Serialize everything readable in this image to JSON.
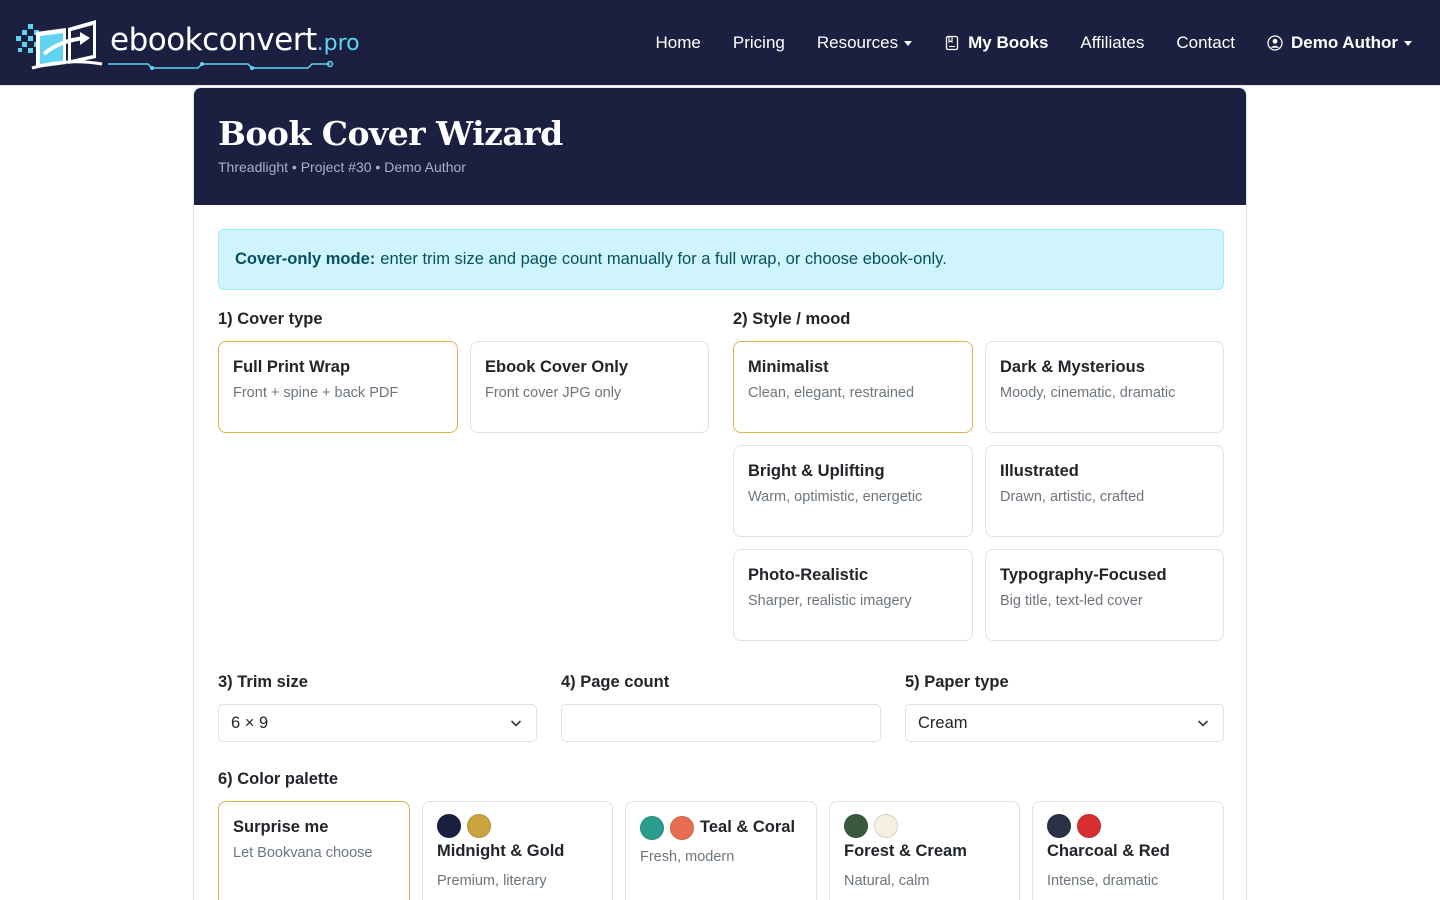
{
  "brand": {
    "name_main": "ebookconvert",
    "name_suffix": ".pro",
    "colors": {
      "navy": "#1b2040",
      "accent": "#5fd4f0",
      "selected_border": "#e0b24a"
    }
  },
  "nav": {
    "home": "Home",
    "pricing": "Pricing",
    "resources": "Resources",
    "my_books": "My Books",
    "affiliates": "Affiliates",
    "contact": "Contact",
    "user": "Demo Author"
  },
  "header": {
    "title": "Book Cover Wizard",
    "subtitle": "Threadlight • Project #30 • Demo Author"
  },
  "alert": {
    "strong": "Cover-only mode:",
    "text": "enter trim size and page count manually for a full wrap, or choose ebook-only."
  },
  "cover_type": {
    "label": "1) Cover type",
    "options": [
      {
        "title": "Full Print Wrap",
        "desc": "Front + spine + back PDF",
        "selected": true
      },
      {
        "title": "Ebook Cover Only",
        "desc": "Front cover JPG only",
        "selected": false
      }
    ]
  },
  "style": {
    "label": "2) Style / mood",
    "options": [
      {
        "title": "Minimalist",
        "desc": "Clean, elegant, restrained",
        "selected": true
      },
      {
        "title": "Dark & Mysterious",
        "desc": "Moody, cinematic, dramatic",
        "selected": false
      },
      {
        "title": "Bright & Uplifting",
        "desc": "Warm, optimistic, energetic",
        "selected": false
      },
      {
        "title": "Illustrated",
        "desc": "Drawn, artistic, crafted",
        "selected": false
      },
      {
        "title": "Photo-Realistic",
        "desc": "Sharper, realistic imagery",
        "selected": false
      },
      {
        "title": "Typography-Focused",
        "desc": "Big title, text-led cover",
        "selected": false
      }
    ]
  },
  "trim": {
    "label": "3) Trim size",
    "value": "6 × 9"
  },
  "pages": {
    "label": "4) Page count",
    "value": ""
  },
  "paper": {
    "label": "5) Paper type",
    "value": "Cream"
  },
  "palette": {
    "label": "6) Color palette",
    "options": [
      {
        "title": "Surprise me",
        "desc": "Let Bookvana choose",
        "colors": [],
        "selected": true
      },
      {
        "title": "Midnight & Gold",
        "desc": "Premium, literary",
        "colors": [
          "#1b2040",
          "#c9a43e"
        ],
        "selected": false
      },
      {
        "title": "Teal & Coral",
        "desc": "Fresh, modern",
        "colors": [
          "#2a9d8f",
          "#e76f51"
        ],
        "selected": false
      },
      {
        "title": "Forest & Cream",
        "desc": "Natural, calm",
        "colors": [
          "#3a5a40",
          "#f5f0e1"
        ],
        "selected": false
      },
      {
        "title": "Charcoal & Red",
        "desc": "Intense, dramatic",
        "colors": [
          "#2b3245",
          "#d62f2f"
        ],
        "selected": false
      }
    ]
  }
}
